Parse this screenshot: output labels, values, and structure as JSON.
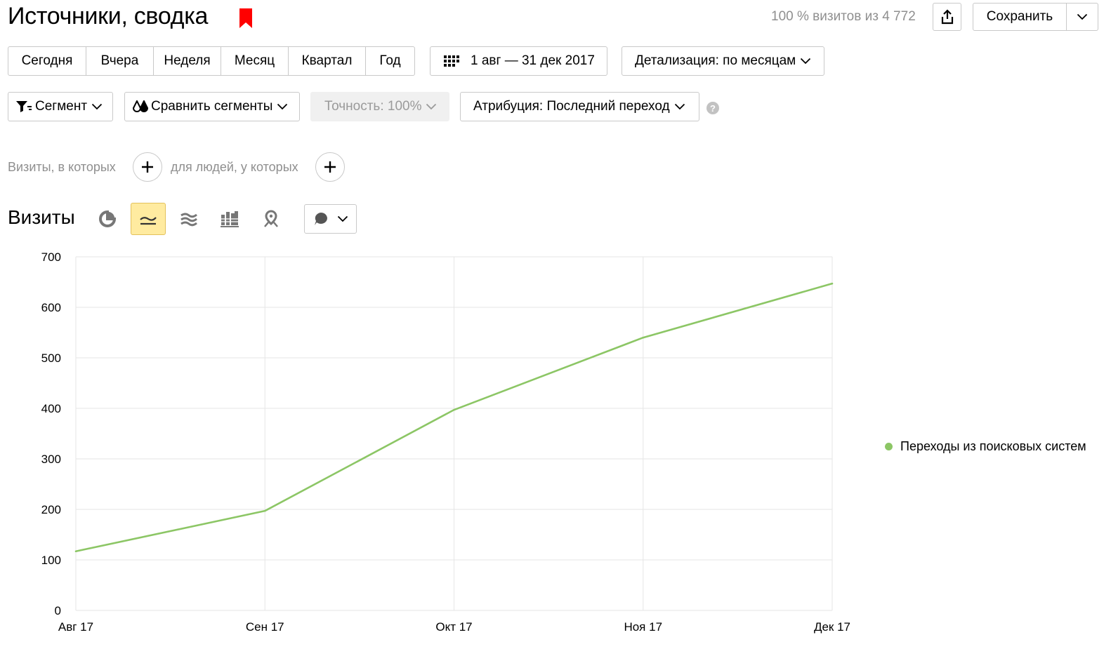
{
  "header": {
    "title": "Источники, сводка",
    "visits_info": "100 % визитов из 4 772",
    "save_label": "Сохранить"
  },
  "period": {
    "options": [
      "Сегодня",
      "Вчера",
      "Неделя",
      "Месяц",
      "Квартал",
      "Год"
    ],
    "date_range": "1 авг — 31 дек 2017",
    "detail": "Детализация: по месяцам"
  },
  "filters": {
    "segment": "Сегмент",
    "compare": "Сравнить сегменты",
    "accuracy": "Точность: 100%",
    "attribution": "Атрибуция: Последний переход",
    "help": "?"
  },
  "conditions": {
    "visits_label": "Визиты, в которых",
    "people_label": "для людей, у которых"
  },
  "chart_header": {
    "title": "Визиты",
    "chart_types": [
      "pie-icon",
      "line-icon",
      "area-icon",
      "stacked-bar-icon",
      "map-icon"
    ],
    "active_type": "line-icon"
  },
  "colors": {
    "accent_red": "#ff0000",
    "series_green": "#8cc665",
    "active_bg": "#ffeba0"
  },
  "chart_data": {
    "type": "line",
    "title": "",
    "xlabel": "",
    "ylabel": "",
    "categories": [
      "Авг 17",
      "Сен 17",
      "Окт 17",
      "Ноя 17",
      "Дек 17"
    ],
    "series": [
      {
        "name": "Переходы из поисковых систем",
        "color": "#8cc665",
        "values": [
          117,
          197,
          397,
          540,
          647
        ]
      }
    ],
    "ylim": [
      0,
      700
    ],
    "yticks": [
      "0",
      "100",
      "200",
      "300",
      "400",
      "500",
      "600",
      "700"
    ],
    "grid": true,
    "legend_position": "right"
  }
}
